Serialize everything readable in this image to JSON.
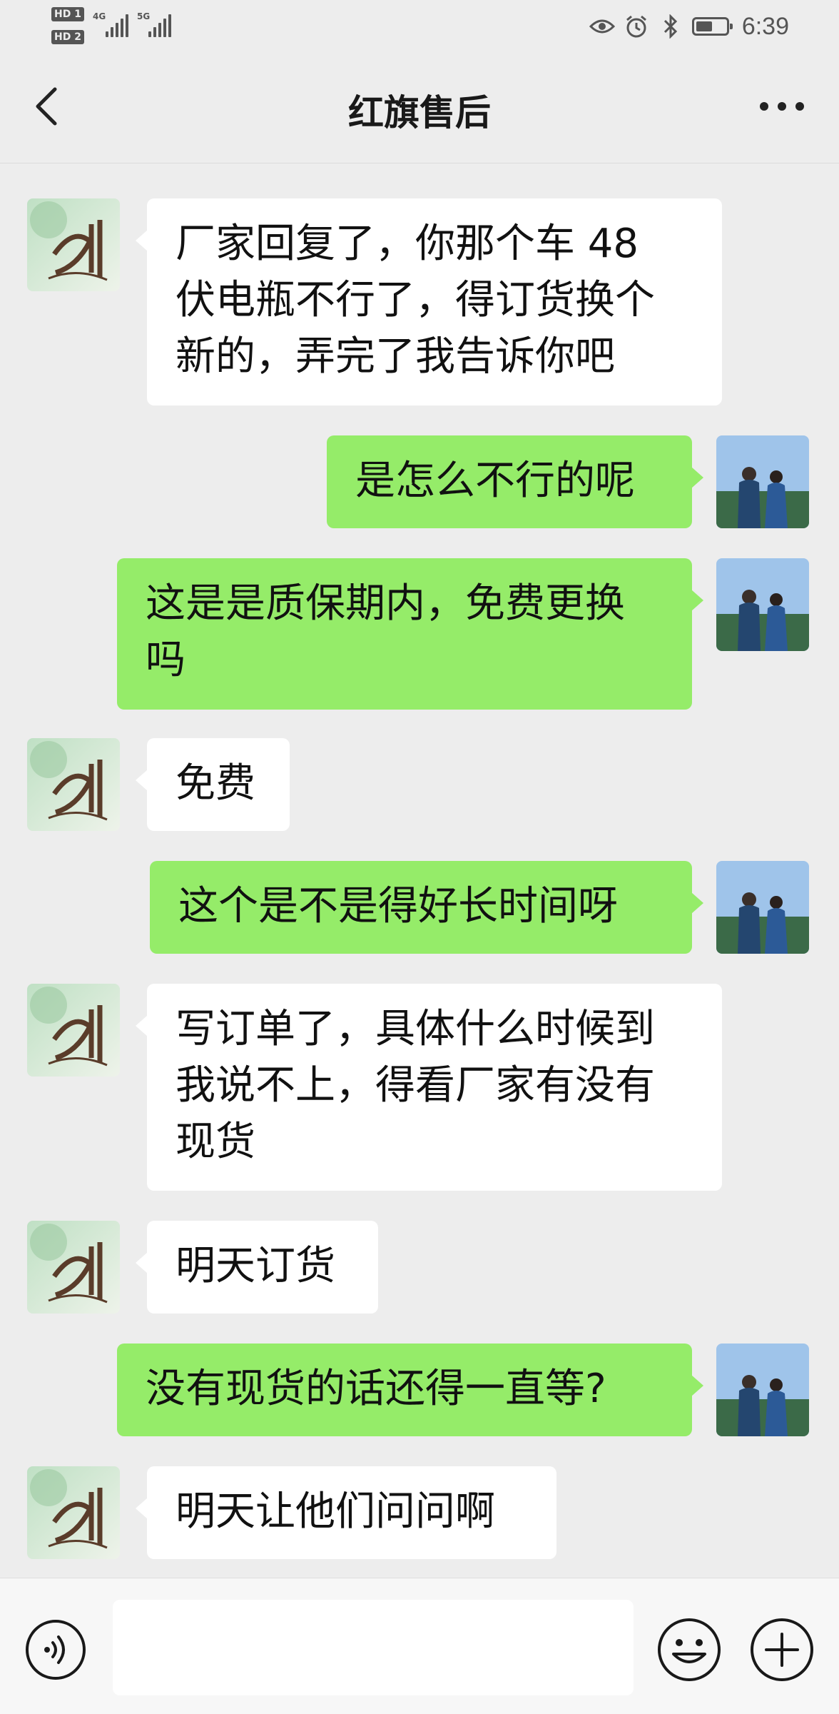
{
  "status_bar": {
    "sim1_label": "HD 1",
    "sim2_label": "HD 2",
    "network1": "4G",
    "network2": "5G",
    "time": "6:39",
    "battery_level": 0.55,
    "icons": [
      "eye-icon",
      "alarm-icon",
      "bluetooth-icon",
      "battery-icon"
    ]
  },
  "header": {
    "title": "红旗售后",
    "back_icon": "chevron-left-icon",
    "more_icon": "ellipsis-icon"
  },
  "colors": {
    "background": "#ededed",
    "incoming_bubble": "#ffffff",
    "outgoing_bubble": "#95ec69",
    "input_bar": "#f7f7f7"
  },
  "messages": [
    {
      "side": "in",
      "text": "厂家回复了，你那个车 48\n伏电瓶不行了，得订货换个\n新的，弄完了我告诉你吧"
    },
    {
      "side": "out",
      "text": "是怎么不行的呢"
    },
    {
      "side": "out",
      "text": "这是是质保期内，免费更换\n吗"
    },
    {
      "side": "in",
      "text": "免费"
    },
    {
      "side": "out",
      "text": "这个是不是得好长时间呀"
    },
    {
      "side": "in",
      "text": "写订单了，具体什么时候到\n我说不上，得看厂家有没有\n现货"
    },
    {
      "side": "in",
      "text": "明天订货"
    },
    {
      "side": "out",
      "text": "没有现货的话还得一直等?"
    },
    {
      "side": "in",
      "text": "明天让他们问问啊"
    }
  ],
  "input_bar": {
    "placeholder": "",
    "voice_icon": "voice-icon",
    "emoji_icon": "emoji-icon",
    "add_icon": "plus-icon"
  }
}
